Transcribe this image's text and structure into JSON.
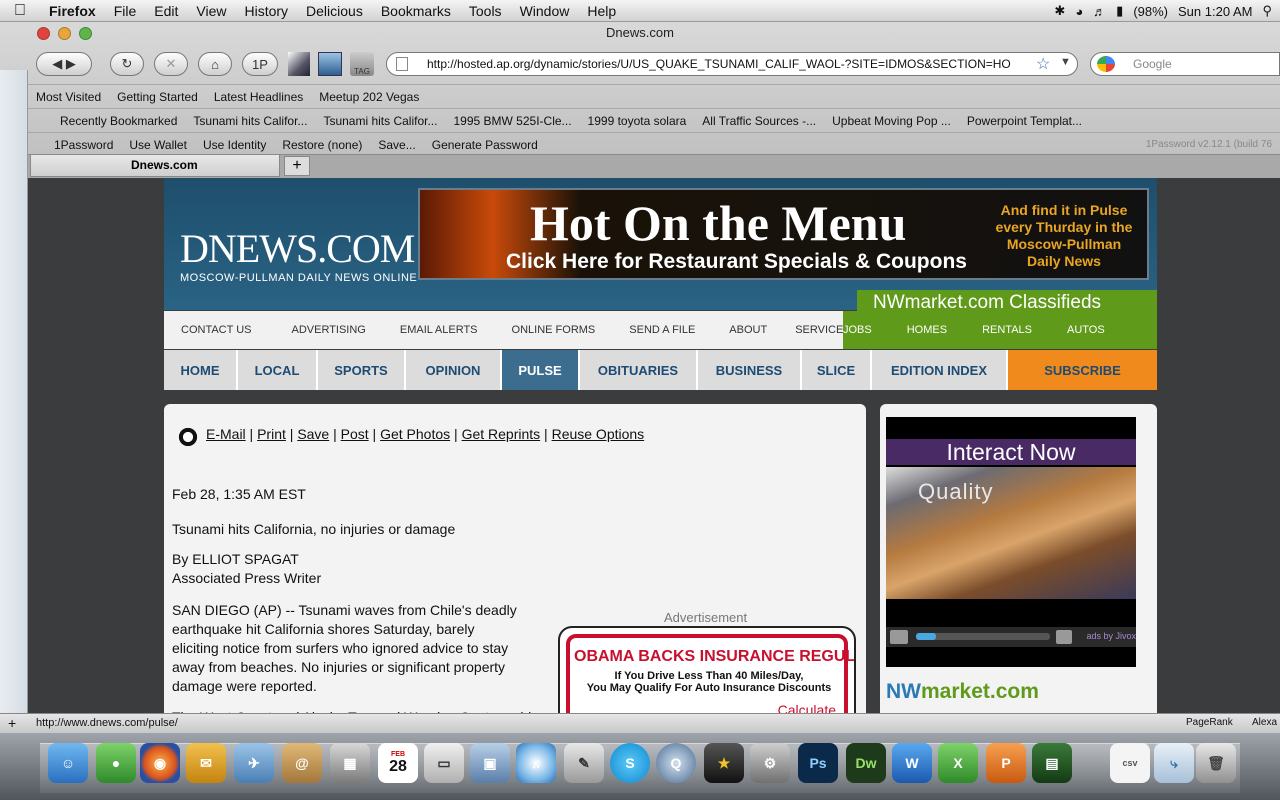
{
  "menubar": {
    "app": "Firefox",
    "items": [
      "File",
      "Edit",
      "View",
      "History",
      "Delicious",
      "Bookmarks",
      "Tools",
      "Window",
      "Help"
    ],
    "battery": "(98%)",
    "clock": "Sun 1:20 AM"
  },
  "window": {
    "title": "Dnews.com"
  },
  "nav": {
    "onep_label": "1P",
    "tag_label": "TAG",
    "url": "http://hosted.ap.org/dynamic/stories/U/US_QUAKE_TSUNAMI_CALIF_WAOL-?SITE=IDMOS&SECTION=HO",
    "search_placeholder": "Google"
  },
  "bookmarks": {
    "row1": [
      "Most Visited",
      "Getting Started",
      "Latest Headlines",
      "Meetup 202 Vegas"
    ],
    "row2": [
      "Recently Bookmarked",
      "Tsunami hits Califor...",
      "Tsunami hits Califor...",
      "1995 BMW 525I-Cle...",
      "1999 toyota solara",
      "All Traffic Sources -...",
      "Upbeat Moving Pop ...",
      "Powerpoint Templat..."
    ],
    "row3": [
      "1Password",
      "Use Wallet",
      "Use Identity",
      "Restore (none)",
      "Save...",
      "Generate Password"
    ],
    "row3_version": "1Password v2.12.1 (build 76"
  },
  "tabs": [
    {
      "label": "Dnews.com"
    }
  ],
  "site": {
    "logo_main": "DNEWS.COM",
    "logo_sub": "MOSCOW-PULLMAN DAILY NEWS ONLINE",
    "banner_title": "Hot On the Menu",
    "banner_sub": "Click Here for Restaurant Specials & Coupons",
    "banner_side": "And find it in Pulse every Thurday in the Moscow-Pullman Daily News",
    "nwmarket_title": "NWmarket.com Classifieds",
    "subnav": [
      "CONTACT US",
      "ADVERTISING",
      "EMAIL ALERTS",
      "ONLINE FORMS",
      "SEND A FILE",
      "ABOUT",
      "SERVICES"
    ],
    "nwnav": [
      "JOBS",
      "HOMES",
      "RENTALS",
      "AUTOS"
    ],
    "mainnav": [
      "HOME",
      "LOCAL",
      "SPORTS",
      "OPINION",
      "PULSE",
      "OBITUARIES",
      "BUSINESS",
      "SLICE",
      "EDITION INDEX",
      "SUBSCRIBE"
    ]
  },
  "article": {
    "tools": [
      "E-Mail",
      "Print",
      "Save",
      "Post",
      "Get Photos",
      "Get Reprints",
      "Reuse Options"
    ],
    "date": "Feb 28, 1:35 AM EST",
    "headline": "Tsunami hits California, no injuries or damage",
    "byline": "By ELLIOT SPAGAT",
    "affiliation": "Associated Press Writer",
    "body1": "SAN DIEGO (AP) -- Tsunami waves from Chile's deadly earthquake hit California shores Saturday, barely eliciting notice from surfers who ignored advice to stay away from beaches. No injuries or significant property damage were reported.",
    "body2": "The West Coast and Alaska Tsunami Warning Center said",
    "ad_label": "Advertisement",
    "ad_head": "OBAMA BACKS INSURANCE REGULATION",
    "ad_line1": "If You Drive Less Than 40 Miles/Day,",
    "ad_line2": "You May Qualify For Auto Insurance Discounts",
    "ad_cta": "Calculate"
  },
  "sidebar_ad": {
    "title": "Interact Now",
    "overlay": "Quality",
    "ads_by": "ads by Jivox",
    "progress": 0.15,
    "nwmarket_logo_a": "NW",
    "nwmarket_logo_b": "market.com"
  },
  "status": {
    "url": "http://www.dnews.com/pulse/",
    "pagerank": "PageRank",
    "alexa": "Alexa"
  },
  "dock": {
    "calendar_day": "28",
    "calendar_month": "FEB"
  }
}
